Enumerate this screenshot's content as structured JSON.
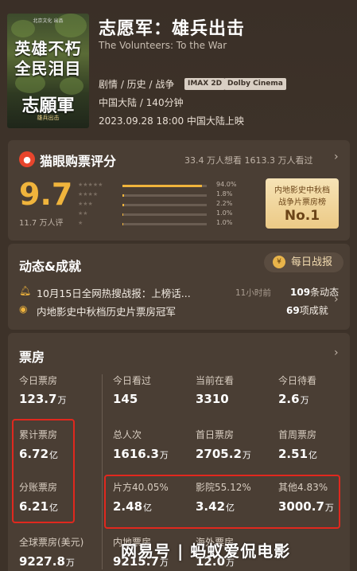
{
  "movie": {
    "poster_text_top": "北京文化 出品",
    "poster_line1": "英雄不朽",
    "poster_line2": "全民泪目",
    "poster_name": "志願軍",
    "poster_sub": "雄兵出击",
    "title": "志愿军：雄兵出击",
    "en_title": "The Volunteers: To the War",
    "genre": "剧情 / 历史 / 战争",
    "tags": [
      "IMAX 2D",
      "Dolby Cinema"
    ],
    "region_runtime": "中国大陆 / 140分钟",
    "release": "2023.09.28 18:00 中国大陆上映"
  },
  "rating": {
    "title": "猫眼购票评分",
    "stats": "33.4 万人想看  1613.3 万人看过",
    "score": "9.7",
    "count": "11.7 万人评",
    "rows": [
      {
        "stars": "★★★★★",
        "pct_label": "94.0%",
        "pct": 94.0
      },
      {
        "stars": "★★★★",
        "pct_label": "1.8%",
        "pct": 1.8
      },
      {
        "stars": "★★★",
        "pct_label": "2.2%",
        "pct": 2.2
      },
      {
        "stars": "★★",
        "pct_label": "1.0%",
        "pct": 1.0
      },
      {
        "stars": "★",
        "pct_label": "1.0%",
        "pct": 1.0
      }
    ],
    "badge_line1": "内地影史中秋档",
    "badge_line2": "战争片票房榜",
    "badge_rank": "No.1"
  },
  "news": {
    "title": "动态&成就",
    "daily_button": "每日战报",
    "items": [
      {
        "icon": "bell-icon",
        "text": "10月15日全网热搜战报：上榜话...",
        "meta": "11小时前"
      },
      {
        "icon": "medal-icon",
        "text": "内地影史中秋档历史片票房冠军",
        "meta": ""
      }
    ],
    "count1_num": "109",
    "count1_unit": "条动态",
    "count2_num": "69",
    "count2_unit": "项成就"
  },
  "boxoffice": {
    "title": "票房",
    "row1": [
      {
        "label": "今日票房",
        "value": "123.7",
        "unit": "万"
      },
      {
        "label": "今日看过",
        "value": "145",
        "unit": ""
      },
      {
        "label": "当前在看",
        "value": "3310",
        "unit": ""
      },
      {
        "label": "今日待看",
        "value": "2.6",
        "unit": "万"
      }
    ],
    "row2": [
      {
        "label": "累计票房",
        "value": "6.72",
        "unit": "亿"
      },
      {
        "label": "总人次",
        "value": "1616.3",
        "unit": "万"
      },
      {
        "label": "首日票房",
        "value": "2705.2",
        "unit": "万"
      },
      {
        "label": "首周票房",
        "value": "2.51",
        "unit": "亿"
      }
    ],
    "row3": [
      {
        "label": "分账票房",
        "value": "6.21",
        "unit": "亿"
      },
      {
        "label": "片方40.05%",
        "value": "2.48",
        "unit": "亿"
      },
      {
        "label": "影院55.12%",
        "value": "3.42",
        "unit": "亿"
      },
      {
        "label": "其他4.83%",
        "value": "3000.7",
        "unit": "万"
      }
    ],
    "row4": [
      {
        "label": "全球票房(美元)",
        "value": "9227.8",
        "unit": "万"
      },
      {
        "label": "内地票房",
        "value": "9215.7",
        "unit": "万"
      },
      {
        "label": "海外票房",
        "value": "12.0",
        "unit": "万"
      }
    ]
  },
  "watermark": "网易号 | 蚂蚁爱侃电影",
  "colors": {
    "accent": "#f0b43c",
    "highlight_box": "#e0281e",
    "background": "#3d3229"
  }
}
